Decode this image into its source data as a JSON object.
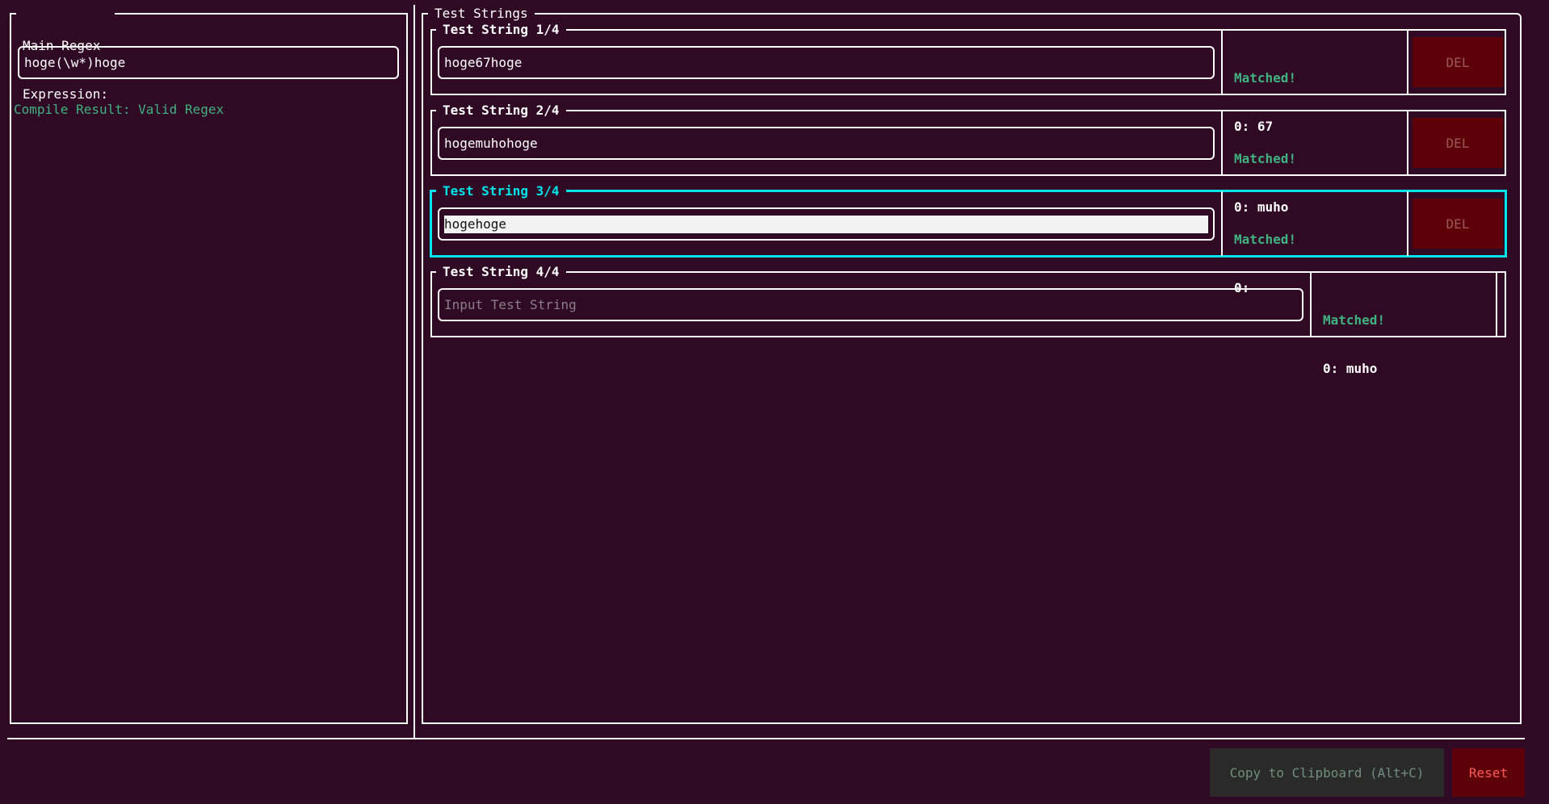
{
  "main_regex": {
    "title_line1": "Main Regex",
    "title_line2": "Expression:",
    "value": "hoge(\\w*)hoge",
    "compile_result": "Compile Result: Valid Regex"
  },
  "test_strings": {
    "title": "Test Strings",
    "items": [
      {
        "title": "Test String 1/4",
        "value": "hoge67hoge",
        "placeholder": "",
        "status": "Matched!",
        "result": "0: 67",
        "del_label": "DEL"
      },
      {
        "title": "Test String 2/4",
        "value": "hogemuhohoge",
        "placeholder": "",
        "status": "Matched!",
        "result": "0: muho",
        "del_label": "DEL"
      },
      {
        "title": "Test String 3/4",
        "value": "hogehoge",
        "placeholder": "",
        "status": "Matched!",
        "result": "0:",
        "del_label": "DEL"
      },
      {
        "title": "Test String 4/4",
        "value": "",
        "placeholder": "Input Test String",
        "status": "Matched!",
        "result": "0: muho"
      }
    ]
  },
  "footer": {
    "copy_label": "Copy to Clipboard (Alt+C)",
    "reset_label": "Reset"
  },
  "colors": {
    "background": "#300a24",
    "accent_focus": "#00e5ea",
    "matched": "#3fb27f",
    "del_bg": "#5e0007",
    "reset_bg": "#5e0007",
    "reset_text": "#ff5a5a",
    "copy_bg": "#2a2a2a"
  }
}
